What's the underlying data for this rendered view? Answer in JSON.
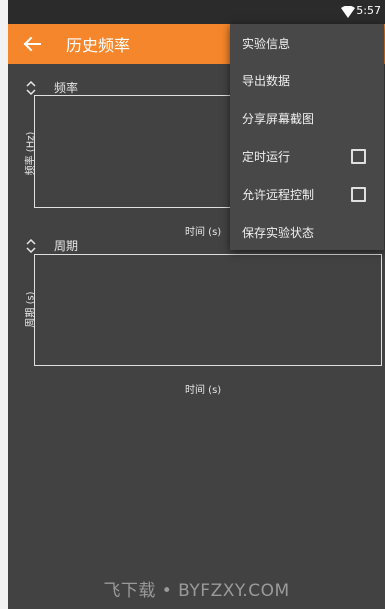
{
  "status_bar": {
    "time": "5:57",
    "icons": [
      "wifi-icon"
    ]
  },
  "app_bar": {
    "title": "历史频率",
    "back_icon": "arrow-left-icon"
  },
  "charts": [
    {
      "title": "频率",
      "y_label": "频率 (Hz)",
      "x_label": "时间 (s)",
      "toggle_icon": "unfold-icon"
    },
    {
      "title": "周期",
      "y_label": "周期 (s)",
      "x_label": "时间 (s)",
      "toggle_icon": "unfold-icon"
    }
  ],
  "overflow_menu": {
    "items": [
      {
        "label": "实验信息",
        "checkbox": false
      },
      {
        "label": "导出数据",
        "checkbox": false
      },
      {
        "label": "分享屏幕截图",
        "checkbox": false
      },
      {
        "label": "定时运行",
        "checkbox": true,
        "checked": false
      },
      {
        "label": "允许远程控制",
        "checkbox": true,
        "checked": false
      },
      {
        "label": "保存实验状态",
        "checkbox": false
      }
    ]
  },
  "watermark": "飞下载 • BYFZXY.COM",
  "colors": {
    "accent": "#f5862b",
    "background": "#424242",
    "menu_bg": "#484848",
    "status_bar": "#2b2b2b"
  }
}
